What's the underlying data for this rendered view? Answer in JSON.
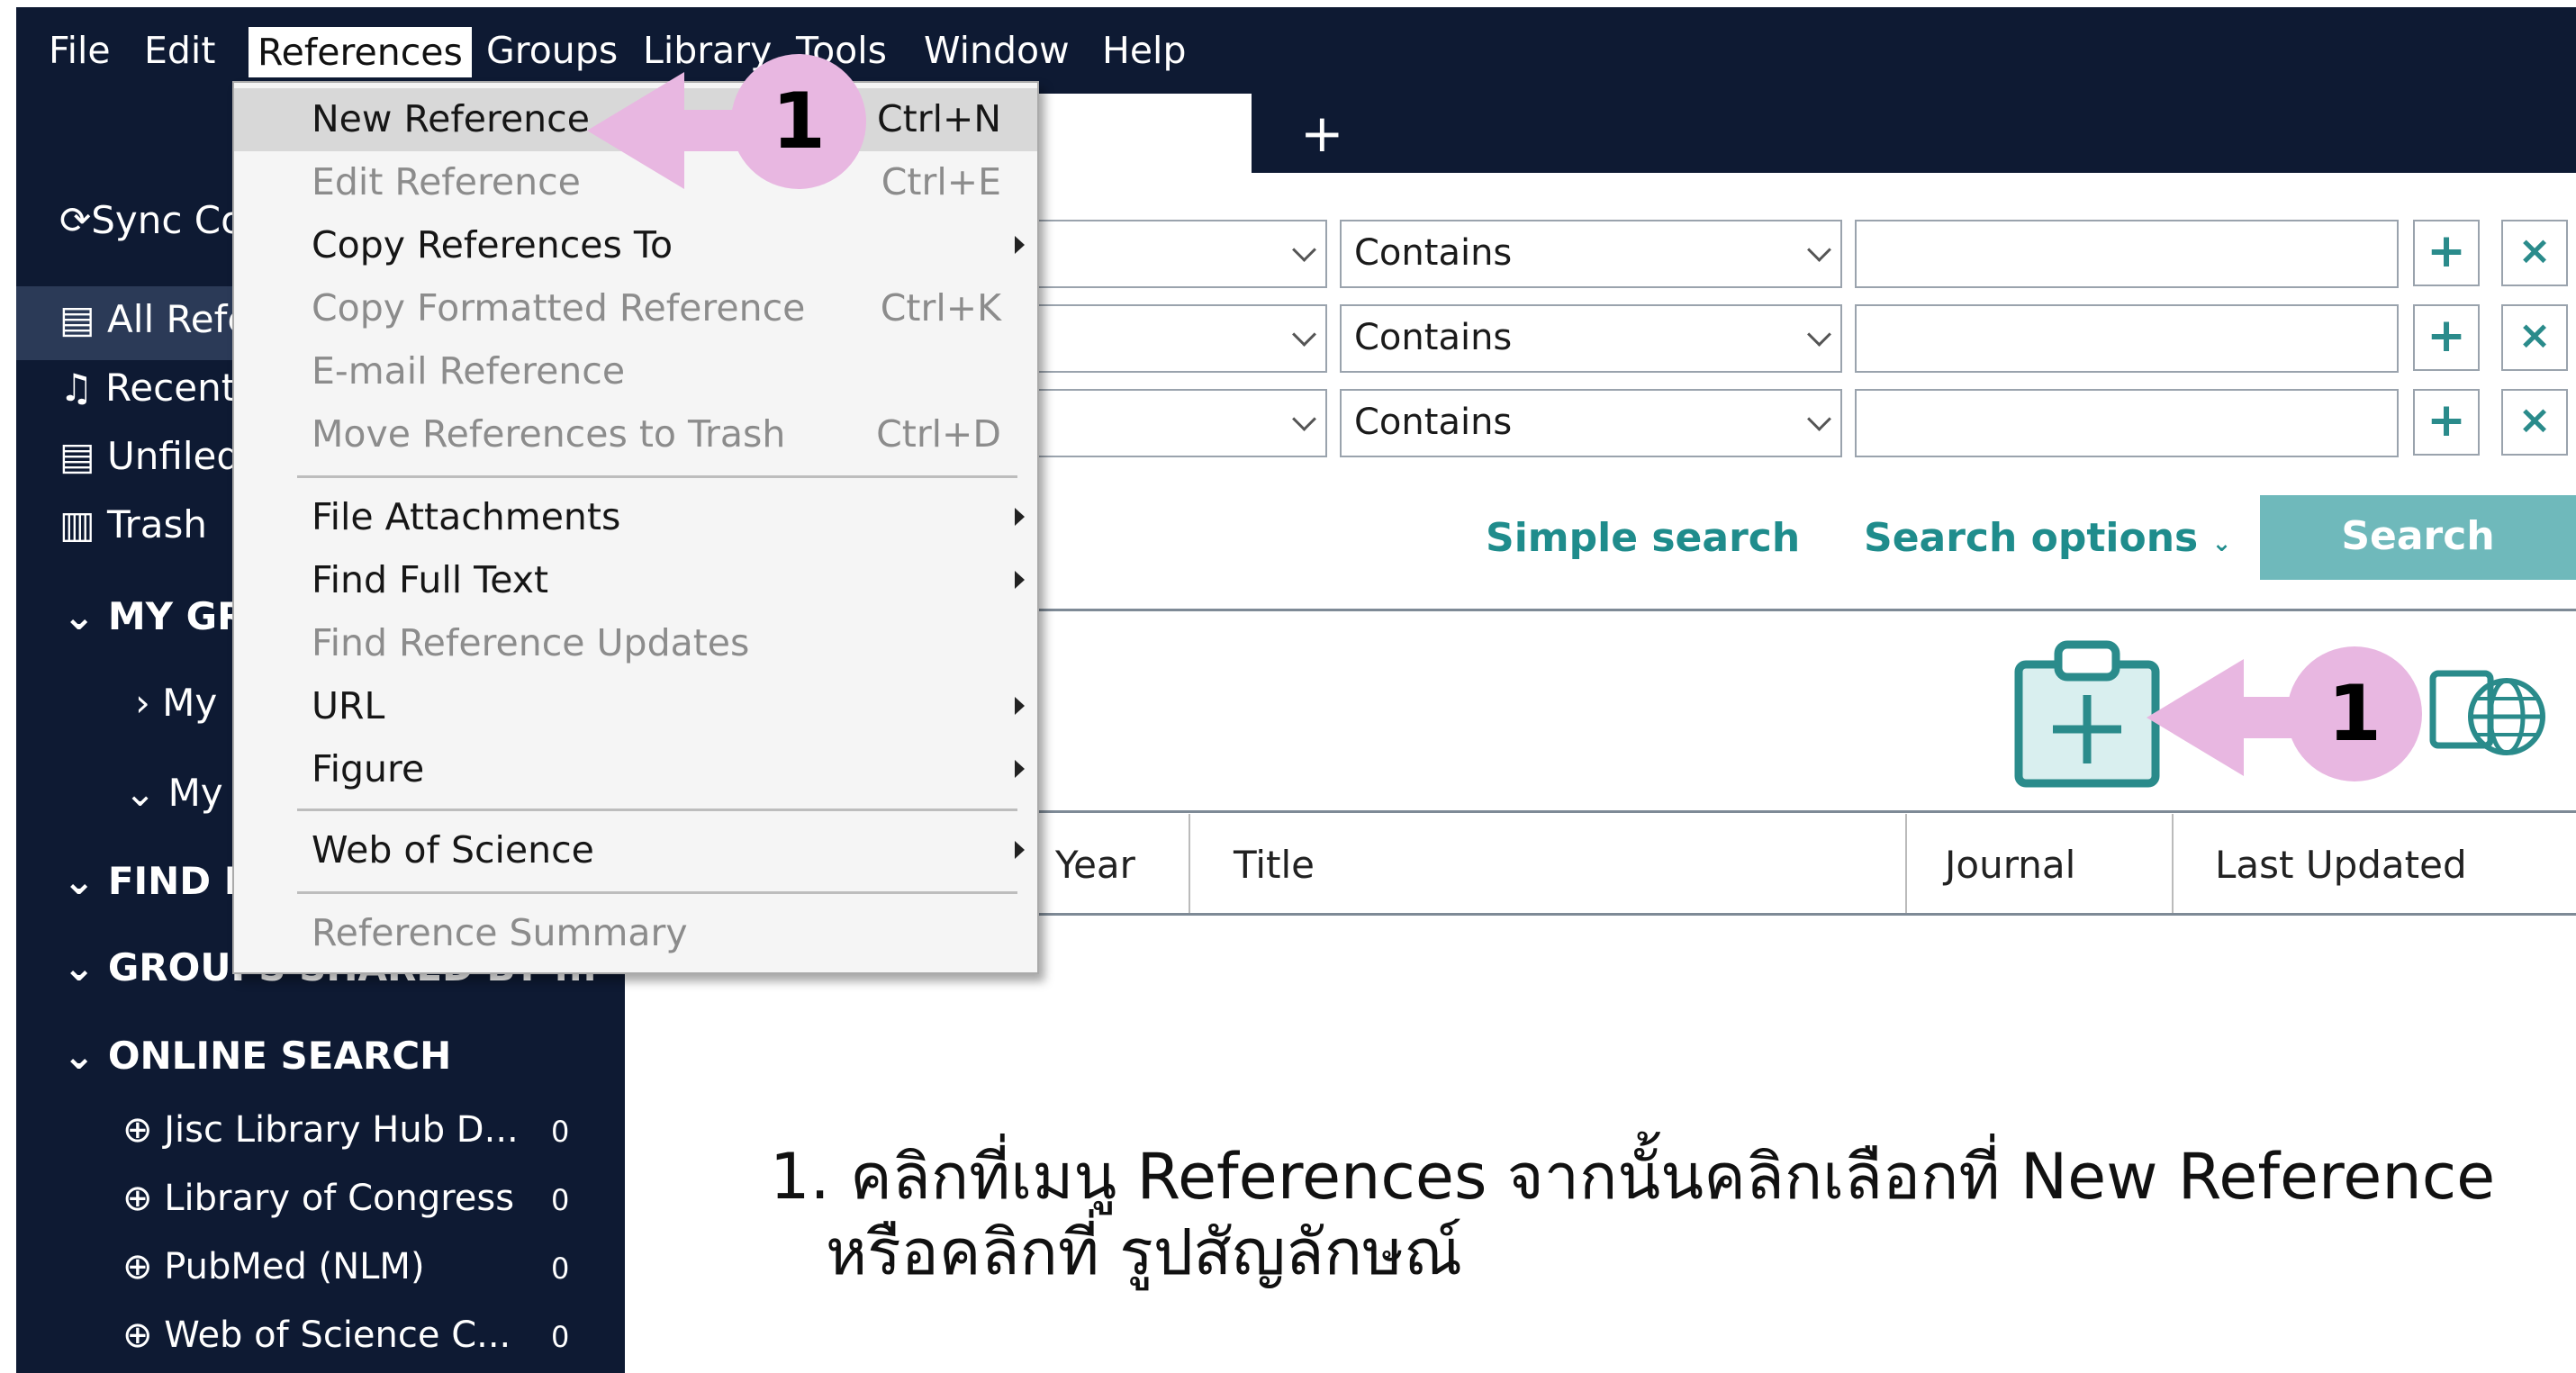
{
  "menubar": {
    "items": [
      "File",
      "Edit",
      "References",
      "Groups",
      "Library",
      "Tools",
      "Window",
      "Help"
    ]
  },
  "tabs": {
    "new_tab": "+"
  },
  "sidebar": {
    "sync": "Sync Co",
    "items": [
      "All Refe",
      "Recent",
      "Unfiled",
      "Trash"
    ],
    "my_groups": "MY GR",
    "groups": [
      "My",
      "My"
    ],
    "find_full_text": "FIND F",
    "groups_shared": "GROUPS SHARED BY ...",
    "online_search": "ONLINE SEARCH",
    "online": [
      {
        "label": "Jisc Library Hub D...",
        "count": "0"
      },
      {
        "label": "Library of Congress",
        "count": "0"
      },
      {
        "label": "PubMed (NLM)",
        "count": "0"
      },
      {
        "label": "Web of Science C...",
        "count": "0"
      }
    ]
  },
  "search": {
    "rows": [
      {
        "operator": "Contains",
        "add": "+",
        "remove": "×"
      },
      {
        "operator": "Contains",
        "add": "+",
        "remove": "×"
      },
      {
        "operator": "Contains",
        "add": "+",
        "remove": "×"
      }
    ],
    "simple_search": "Simple search",
    "search_options": "Search options",
    "search_button": "Search"
  },
  "columns": [
    "Year",
    "Title",
    "Journal",
    "Last Updated"
  ],
  "menu": {
    "items": [
      {
        "label": "New Reference",
        "shortcut": "Ctrl+N",
        "state": "enabled",
        "highlighted": true
      },
      {
        "label": "Edit Reference",
        "shortcut": "Ctrl+E",
        "state": "disabled"
      },
      {
        "label": "Copy References To",
        "submenu": true,
        "state": "enabled"
      },
      {
        "label": "Copy Formatted Reference",
        "shortcut": "Ctrl+K",
        "state": "disabled"
      },
      {
        "label": "E-mail Reference",
        "state": "disabled"
      },
      {
        "label": "Move References to Trash",
        "shortcut": "Ctrl+D",
        "state": "disabled"
      },
      {
        "label": "File Attachments",
        "submenu": true,
        "state": "enabled"
      },
      {
        "label": "Find Full Text",
        "submenu": true,
        "state": "enabled"
      },
      {
        "label": "Find Reference Updates",
        "state": "disabled"
      },
      {
        "label": "URL",
        "submenu": true,
        "state": "enabled"
      },
      {
        "label": "Figure",
        "submenu": true,
        "state": "enabled"
      },
      {
        "label": "Web of Science",
        "submenu": true,
        "state": "enabled"
      },
      {
        "label": "Reference Summary",
        "state": "disabled"
      }
    ]
  },
  "annotations": {
    "badge_menu": "1",
    "badge_icon": "1",
    "instruction_line1": "1. คลิกที่เมนู References จากนั้นคลิกเลือกที่ New Reference",
    "instruction_line2": "หรือคลิกที่ รูปสัญลักษณ์"
  },
  "colors": {
    "frame": "#0e1a33",
    "accent_teal": "#1f8c8c",
    "search_button": "#6fb9bb",
    "annotation_pink": "#e8b7e1"
  }
}
